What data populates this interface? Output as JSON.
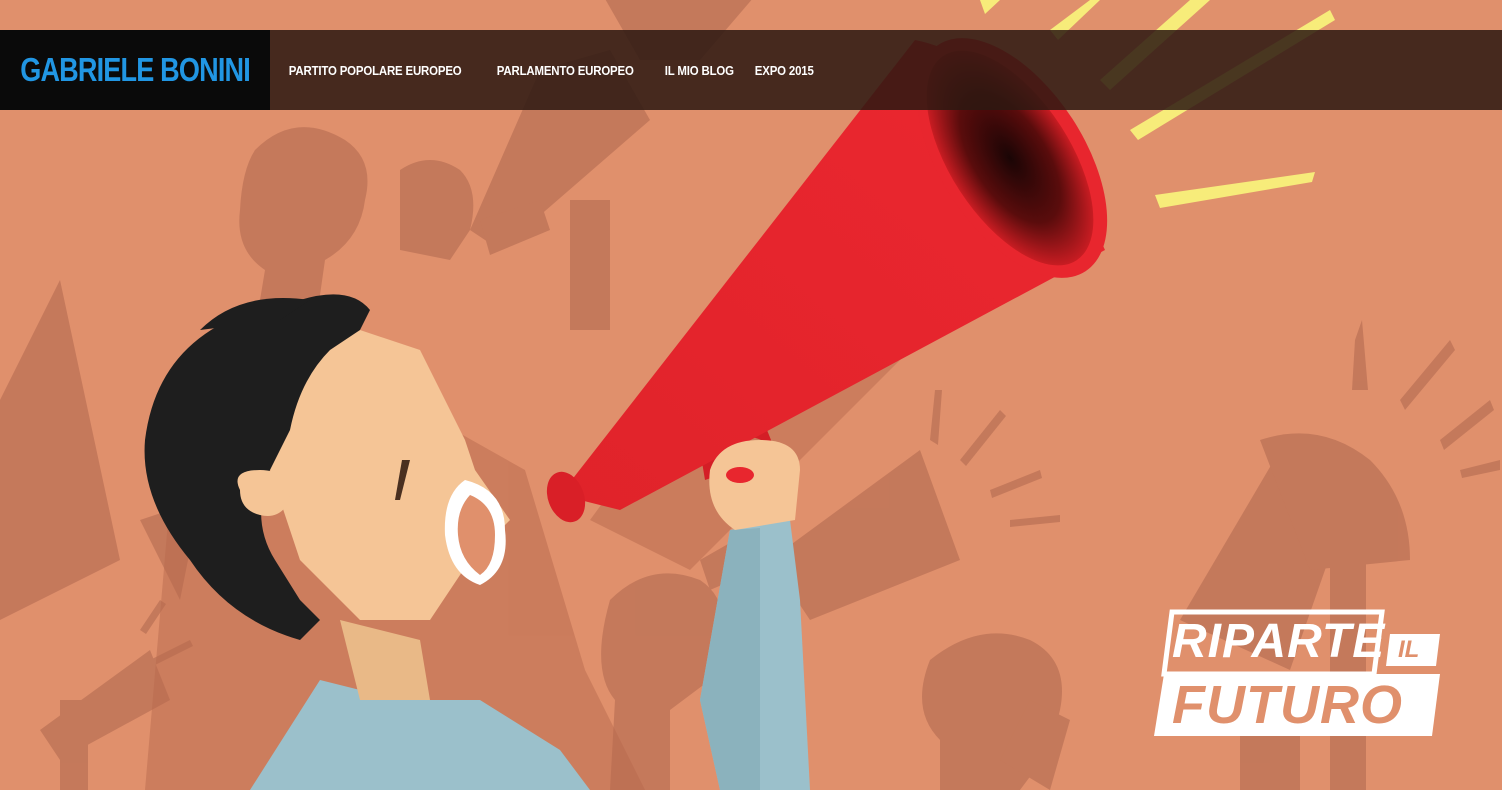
{
  "brand": {
    "name": "GABRIELE BONINI"
  },
  "nav": {
    "items": [
      {
        "label": "PARTITO POPOLARE EUROPEO"
      },
      {
        "label": "PARLAMENTO EUROPEO"
      },
      {
        "label": "IL MIO BLOG"
      },
      {
        "label": "EXPO 2015"
      }
    ]
  },
  "campaign_logo": {
    "line1": "RIPARTE",
    "connector": "IL",
    "line2": "FUTURO"
  },
  "colors": {
    "background": "#e0906c",
    "brand_text": "#2196e3",
    "megaphone": "#e8232c",
    "shirt": "#9bc0cb",
    "skin": "#f5c596",
    "hair": "#1e1e1e",
    "rays": "#f7ec7a"
  }
}
